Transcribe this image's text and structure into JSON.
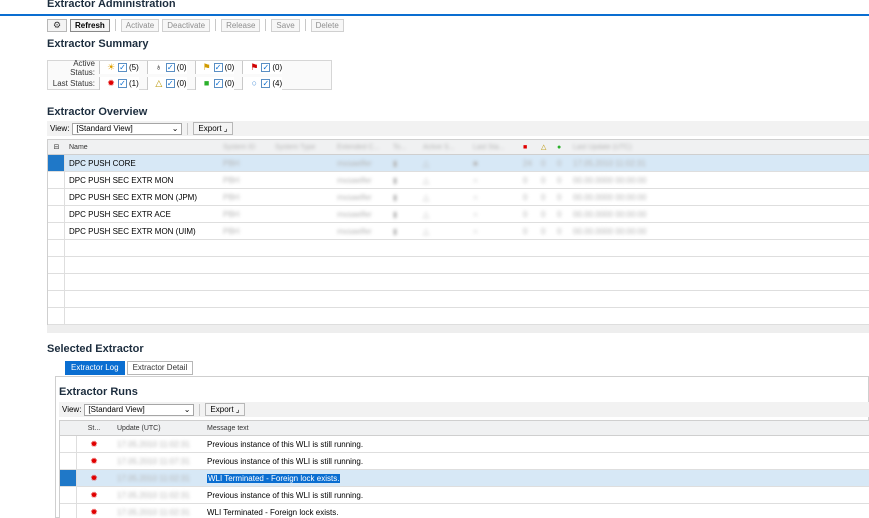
{
  "app": {
    "title": "Extractor Administration"
  },
  "toolbar": {
    "refresh": "Refresh",
    "activate": "Activate",
    "deactivate": "Deactivate",
    "release": "Release",
    "save": "Save",
    "delete": "Delete"
  },
  "summary": {
    "title": "Extractor Summary",
    "active_label": "Active Status:",
    "last_label": "Last Status:",
    "active": [
      "(5)",
      "(0)",
      "(0)",
      "(0)"
    ],
    "last": [
      "(1)",
      "(0)",
      "(0)",
      "(4)"
    ]
  },
  "overview": {
    "title": "Extractor Overview",
    "view_label": "View:",
    "view_value": "[Standard View]",
    "export": "Export",
    "columns": [
      "Name",
      "System ID",
      "System Type",
      "Extended C...",
      "To...",
      "Active S...",
      "Last Sta...",
      "",
      "",
      "",
      "Last Update (UTC)"
    ],
    "rows": [
      {
        "name": "DPC PUSH CORE",
        "sid": "PBH",
        "ext": "mxsaelfer",
        "n1": "24",
        "n2": "0",
        "n3": "0",
        "upd": "17.05.2010 11:02:31"
      },
      {
        "name": "DPC PUSH SEC EXTR MON",
        "sid": "PBH",
        "ext": "mxsaelfer",
        "n1": "0",
        "n2": "0",
        "n3": "0",
        "upd": "00.00.0000 00:00:00"
      },
      {
        "name": "DPC PUSH SEC EXTR MON (JPM)",
        "sid": "PBH",
        "ext": "mxsaelfer",
        "n1": "0",
        "n2": "0",
        "n3": "0",
        "upd": "00.00.0000 00:00:00"
      },
      {
        "name": "DPC PUSH SEC EXTR ACE",
        "sid": "PBH",
        "ext": "mxsaelfer",
        "n1": "0",
        "n2": "0",
        "n3": "0",
        "upd": "00.00.0000 00:00:00"
      },
      {
        "name": "DPC PUSH SEC EXTR MON (UIM)",
        "sid": "PBH",
        "ext": "mxsaelfer",
        "n1": "0",
        "n2": "0",
        "n3": "0",
        "upd": "00.00.0000 00:00:00"
      }
    ]
  },
  "selected": {
    "title": "Selected Extractor",
    "tabs": [
      "Extractor Log",
      "Extractor Detail"
    ]
  },
  "runs": {
    "title": "Extractor Runs",
    "view_label": "View:",
    "view_value": "[Standard View]",
    "export": "Export",
    "columns": [
      "St...",
      "Update (UTC)",
      "Message text"
    ],
    "rows": [
      {
        "time": "17.05.2010 11:02:31",
        "msg": "Previous instance of this WLI is still running."
      },
      {
        "time": "17.05.2010 11:07:31",
        "msg": "Previous instance of this WLI is still running."
      },
      {
        "time": "17.05.2010 11:02:31",
        "msg": "WLI Terminated - Foreign lock exists."
      },
      {
        "time": "17.05.2010 11:02:31",
        "msg": "Previous instance of this WLI is still running."
      },
      {
        "time": "17.05.2010 11:02:31",
        "msg": "WLI Terminated - Foreign lock exists."
      }
    ]
  },
  "colors": {
    "accent": "#0a6ed1",
    "selected_row": "#d7e8f6",
    "error": "#e00000"
  }
}
